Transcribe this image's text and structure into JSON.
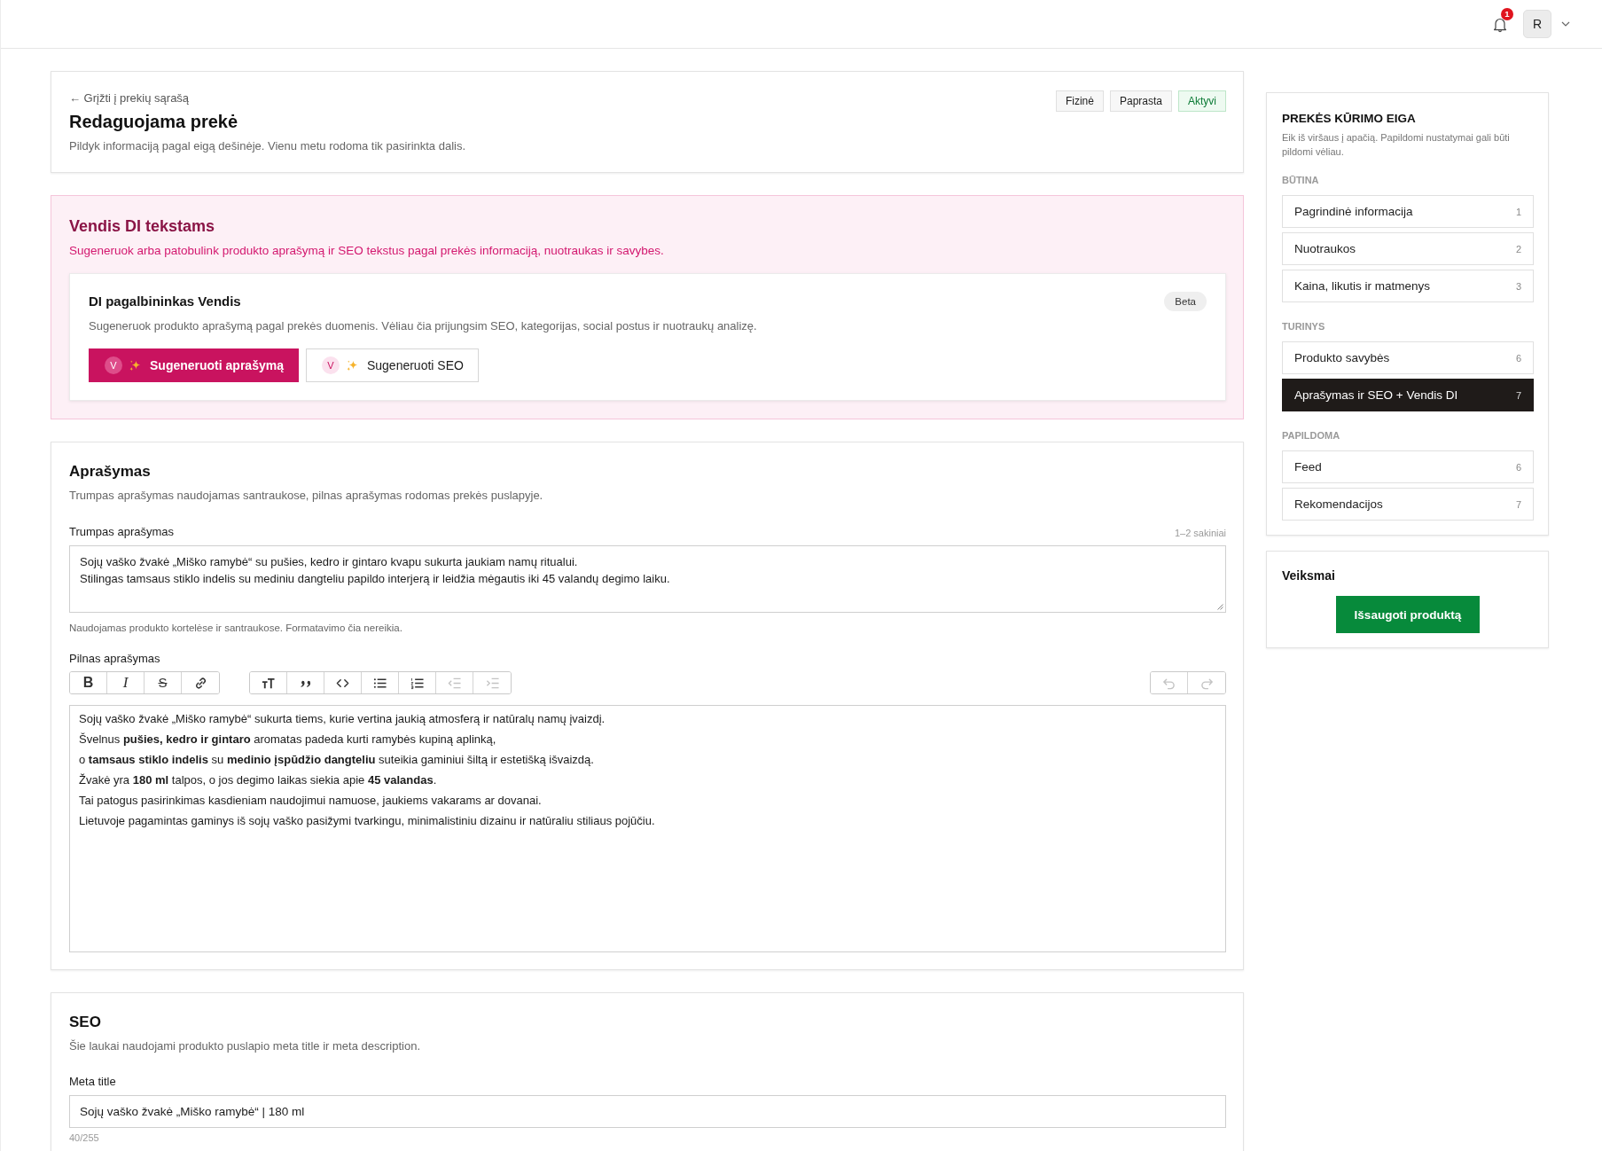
{
  "top_bar": {
    "notification_count": "1",
    "user_initial": "R"
  },
  "product_header": {
    "back_link": "← Grįžti į prekių sąrašą",
    "title": "Redaguojama prekė",
    "subtitle": "Pildyk informaciją pagal eigą dešinėje. Vienu metu rodoma tik pasirinkta dalis.",
    "tags": [
      {
        "label": "Fizinė",
        "kind": "neutral"
      },
      {
        "label": "Paprasta",
        "kind": "neutral"
      },
      {
        "label": "Aktyvi",
        "kind": "success"
      }
    ]
  },
  "ai_panel": {
    "title": "Vendis DI tekstams",
    "subtitle": "Sugeneruok arba patobulink produkto aprašymą ir SEO tekstus pagal prekės informaciją, nuotraukas ir savybes.",
    "assistant": {
      "title": "DI pagalbininkas Vendis",
      "tag": "Beta",
      "description": "Sugeneruok produkto aprašymą pagal prekės duomenis. Vėliau čia prijungsim SEO, kategorijas, social postus ir nuotraukų analizę.",
      "buttons": [
        {
          "kind": "primary",
          "avatar": "V",
          "label": "Sugeneruoti aprašymą"
        },
        {
          "kind": "secondary",
          "avatar": "V",
          "label": "Sugeneruoti SEO"
        }
      ]
    }
  },
  "description": {
    "title": "Aprašymas",
    "subtitle": "Trumpas aprašymas naudojamas santraukose, pilnas aprašymas rodomas prekės puslapyje.",
    "short": {
      "label": "Trumpas aprašymas",
      "hint": "1–2 sakiniai",
      "value": "Sojų vaško žvakė „Miško ramybė“ su pušies, kedro ir gintaro kvapu sukurta jaukiam namų ritualui.\nStilingas tamsaus stiklo indelis su mediniu dangteliu papildo interjerą ir leidžia mėgautis iki 45 valandų degimo laiku.",
      "help": "Naudojamas produkto kortelėse ir santraukose. Formatavimo čia nereikia."
    },
    "full": {
      "label": "Pilnas aprašymas",
      "toolbar": [
        {
          "tools": [
            {
              "kind": "bold",
              "label": "B",
              "disabled": false
            },
            {
              "kind": "italic",
              "label": "I",
              "disabled": false
            },
            {
              "kind": "strike",
              "label": "S",
              "disabled": false
            },
            {
              "kind": "link",
              "disabled": false
            }
          ]
        },
        {
          "tools": [
            {
              "kind": "heading",
              "disabled": false
            },
            {
              "kind": "quote",
              "disabled": false
            },
            {
              "kind": "code",
              "disabled": false
            },
            {
              "kind": "bullet-list",
              "disabled": false
            },
            {
              "kind": "ordered-list",
              "disabled": false
            },
            {
              "kind": "outdent",
              "disabled": true
            },
            {
              "kind": "indent",
              "disabled": true
            }
          ]
        },
        {
          "tools": [
            {
              "kind": "undo",
              "disabled": true
            },
            {
              "kind": "redo",
              "disabled": true
            }
          ]
        }
      ],
      "paragraphs": [
        "Sojų vaško žvakė „Miško ramybė“ sukurta tiems, kurie vertina jaukią atmosferą ir natūralų namų įvaizdį.",
        "Švelnus **pušies, kedro ir gintaro** aromatas padeda kurti ramybės kupiną aplinką,",
        "o **tamsaus stiklo indelis** su **medinio įspūdžio dangteliu** suteikia gaminiui šiltą ir estetišką išvaizdą.",
        "Žvakė yra **180 ml** talpos, o jos degimo laikas siekia apie **45 valandas**.",
        "Tai patogus pasirinkimas kasdieniam naudojimui namuose, jaukiems vakarams ar dovanai.",
        "Lietuvoje pagamintas gaminys iš sojų vaško pasižymi tvarkingu, minimalistiniu dizainu ir natūraliu stiliaus pojūčiu."
      ]
    }
  },
  "seo": {
    "title": "SEO",
    "subtitle": "Šie laukai naudojami produkto puslapio meta title ir meta description.",
    "fields": [
      {
        "label": "Meta title",
        "value": "Sojų vaško žvakė „Miško ramybė“ | 180 ml",
        "counter": "40/255"
      }
    ]
  },
  "sidebar": {
    "title": "PREKĖS KŪRIMO EIGA",
    "description": "Eik iš viršaus į apačią. Papildomi nustatymai gali būti pildomi vėliau.",
    "groups": [
      {
        "label": "BŪTINA",
        "items": [
          {
            "label": "Pagrindinė informacija",
            "step": "1",
            "selected": false
          },
          {
            "label": "Nuotraukos",
            "step": "2",
            "selected": false
          },
          {
            "label": "Kaina, likutis ir matmenys",
            "step": "3",
            "selected": false
          }
        ]
      },
      {
        "label": "TURINYS",
        "items": [
          {
            "label": "Produkto savybės",
            "step": "6",
            "selected": false
          },
          {
            "label": "Aprašymas ir SEO + Vendis DI",
            "step": "7",
            "selected": true
          }
        ]
      },
      {
        "label": "PAPILDOMA",
        "items": [
          {
            "label": "Feed",
            "step": "6",
            "selected": false
          },
          {
            "label": "Rekomendacijos",
            "step": "7",
            "selected": false
          }
        ]
      }
    ]
  },
  "actions": {
    "title": "Veiksmai",
    "button": "Išsaugoti produktą"
  }
}
